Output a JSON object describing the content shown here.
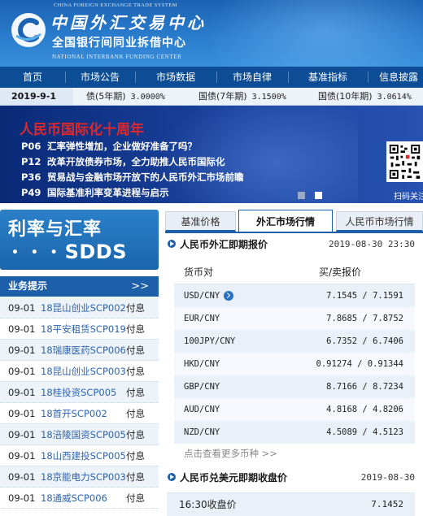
{
  "header": {
    "en_top": "CHINA FOREIGN EXCHANGE TRADE SYSTEM",
    "cn_title": "中国外汇交易中心",
    "cn_subtitle": "全国银行间同业拆借中心",
    "en_subtitle": "NATIONAL INTERBANK FUNDING CENTER"
  },
  "nav": [
    "首页",
    "市场公告",
    "市场数据",
    "市场自律",
    "基准指标",
    "信息披露"
  ],
  "ticker": {
    "date": "2019-9-1",
    "items": [
      {
        "label": "债(5年期)",
        "value": "3.0000%"
      },
      {
        "label": "国债(7年期)",
        "value": "3.1500%"
      },
      {
        "label": "国债(10年期)",
        "value": "3.0614%"
      }
    ]
  },
  "banner": {
    "title": "人民币国际化十周年",
    "items": [
      {
        "code": "P06",
        "text": "汇率弹性增加，企业做好准备了吗？"
      },
      {
        "code": "P12",
        "text": "改革开放债券市场，全力助推人民币国际化"
      },
      {
        "code": "P36",
        "text": "贸易战与金融市场开放下的人民币外汇市场前瞻"
      },
      {
        "code": "P49",
        "text": "国际基准利率变革进程与启示"
      }
    ],
    "qr_label": "扫码关注"
  },
  "sdds": {
    "line1": "利率与汇率",
    "dots": "• • •",
    "line2": "SDDS"
  },
  "tips": {
    "title": "业务提示",
    "more": ">>",
    "rows": [
      {
        "date": "09-01",
        "name": "18昆山创业SCP002",
        "status": "付息"
      },
      {
        "date": "09-01",
        "name": "18平安租赁SCP019",
        "status": "付息"
      },
      {
        "date": "09-01",
        "name": "18瑞康医药SCP006",
        "status": "付息"
      },
      {
        "date": "09-01",
        "name": "18昆山创业SCP003",
        "status": "付息"
      },
      {
        "date": "09-01",
        "name": "18桂投资SCP005",
        "status": "付息"
      },
      {
        "date": "09-01",
        "name": "18首开SCP002",
        "status": "付息"
      },
      {
        "date": "09-01",
        "name": "18涪陵国资SCP005",
        "status": "付息"
      },
      {
        "date": "09-01",
        "name": "18山西建投SCP005",
        "status": "付息"
      },
      {
        "date": "09-01",
        "name": "18京能电力SCP003",
        "status": "付息"
      },
      {
        "date": "09-01",
        "name": "18通威SCP006",
        "status": "付息"
      }
    ]
  },
  "tabs": [
    "基准价格",
    "外汇市场行情",
    "人民币市场行情"
  ],
  "fx": {
    "title": "人民币外汇即期报价",
    "datetime": "2019-08-30  23:30",
    "col_pair": "货币对",
    "col_quote": "买/卖报价",
    "rows": [
      {
        "pair": "USD/CNY",
        "quote": "7.1545 / 7.1591"
      },
      {
        "pair": "EUR/CNY",
        "quote": "7.8685 / 7.8752"
      },
      {
        "pair": "100JPY/CNY",
        "quote": "6.7352 / 6.7406"
      },
      {
        "pair": "HKD/CNY",
        "quote": "0.91274 / 0.91344"
      },
      {
        "pair": "GBP/CNY",
        "quote": "8.7166 / 8.7234"
      },
      {
        "pair": "AUD/CNY",
        "quote": "4.8168 / 4.8206"
      },
      {
        "pair": "NZD/CNY",
        "quote": "4.5089 / 4.5123"
      }
    ],
    "more": "点击查看更多币种 >>"
  },
  "close": {
    "title": "人民币兑美元即期收盘价",
    "date": "2019-08-30",
    "label": "16:30收盘价",
    "value": "7.1452"
  },
  "colors": {
    "nav": "#0d4d96",
    "accent": "#1d5fa8",
    "banner_title": "#e0282c",
    "link": "#2a63b0"
  }
}
